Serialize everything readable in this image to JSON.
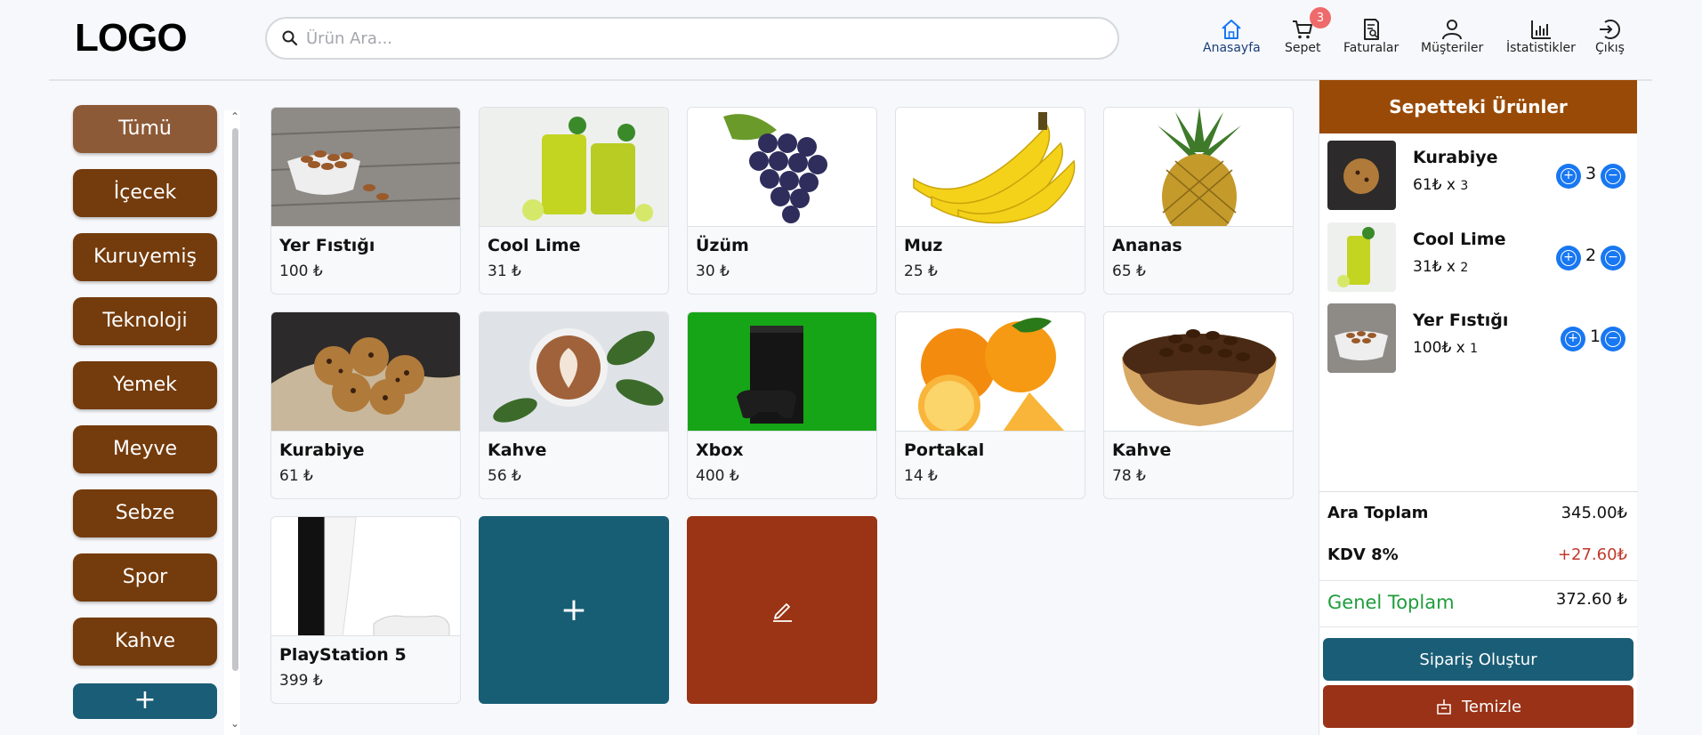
{
  "logo": "LOGO",
  "search": {
    "placeholder": "Ürün Ara..."
  },
  "nav": [
    {
      "label": "Anasayfa",
      "icon": "home-icon"
    },
    {
      "label": "Sepet",
      "icon": "cart-icon",
      "badge": "3"
    },
    {
      "label": "Faturalar",
      "icon": "invoice-icon"
    },
    {
      "label": "Müşteriler",
      "icon": "user-icon"
    },
    {
      "label": "İstatistikler",
      "icon": "bar-chart-icon"
    },
    {
      "label": "Çıkış",
      "icon": "logout-icon"
    }
  ],
  "categories": [
    "Tümü",
    "İçecek",
    "Kuruyemiş",
    "Teknoloji",
    "Yemek",
    "Meyve",
    "Sebze",
    "Spor",
    "Kahve"
  ],
  "category_add_label": "+",
  "products": [
    {
      "name": "Yer Fıstığı",
      "price": "100 ₺"
    },
    {
      "name": "Cool Lime",
      "price": "31 ₺"
    },
    {
      "name": "Üzüm",
      "price": "30 ₺"
    },
    {
      "name": "Muz",
      "price": "25 ₺"
    },
    {
      "name": "Ananas",
      "price": "65 ₺"
    },
    {
      "name": "Kurabiye",
      "price": "61 ₺"
    },
    {
      "name": "Kahve",
      "price": "56 ₺"
    },
    {
      "name": "Xbox",
      "price": "400 ₺"
    },
    {
      "name": "Portakal",
      "price": "14 ₺"
    },
    {
      "name": "Kahve",
      "price": "78 ₺"
    },
    {
      "name": "PlayStation 5",
      "price": "399 ₺"
    }
  ],
  "add_product_label": "+",
  "cart": {
    "title": "Sepetteki Ürünler",
    "items": [
      {
        "name": "Kurabiye",
        "price": "61₺",
        "x": "x",
        "qty": "3",
        "count": "3"
      },
      {
        "name": "Cool Lime",
        "price": "31₺",
        "x": "x",
        "qty": "2",
        "count": "2"
      },
      {
        "name": "Yer Fıstığı",
        "price": "100₺",
        "x": "x",
        "qty": "1",
        "count": "1"
      }
    ],
    "subtotal_label": "Ara Toplam",
    "subtotal_value": "345.00₺",
    "tax_label": "KDV 8%",
    "tax_value": "+27.60₺",
    "total_label": "Genel Toplam",
    "total_value": "372.60 ₺",
    "order_button": "Sipariş Oluştur",
    "clear_button": "Temizle"
  },
  "colors": {
    "category": "#743b0c",
    "category_active": "#8d5a37",
    "cart_header": "#994a06",
    "primary_teal": "#1a5d76",
    "danger_red": "#993217",
    "qty_blue": "#1877f2",
    "total_green": "#1e9d3c",
    "tax_red": "#c0392b"
  }
}
